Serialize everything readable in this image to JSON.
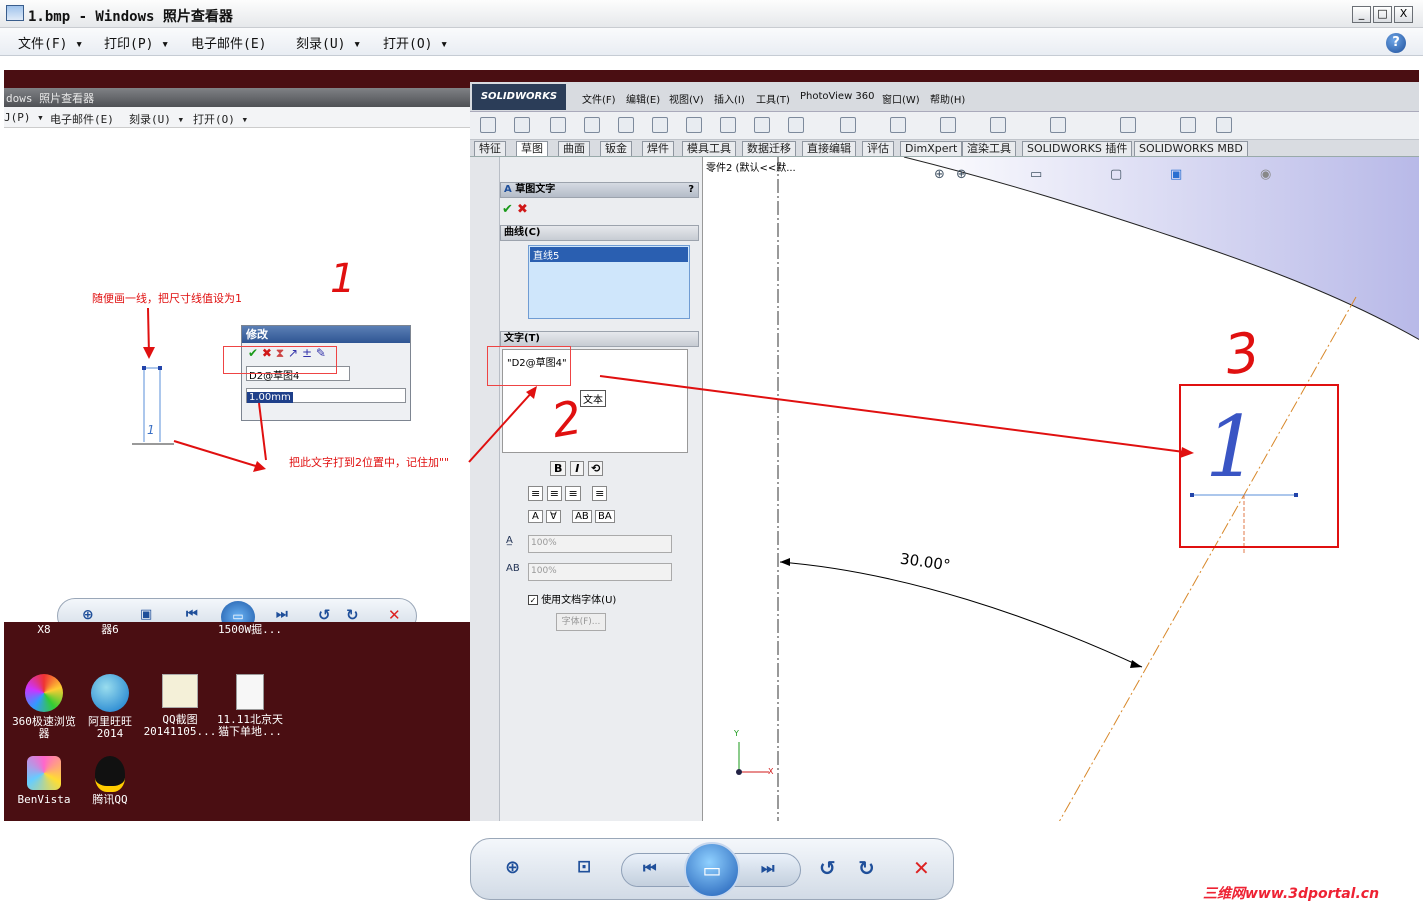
{
  "window": {
    "title": "1.bmp - Windows 照片查看器",
    "minimize": "_",
    "maximize": "□",
    "close": "X"
  },
  "menu": [
    "文件(F) ▾",
    "打印(P) ▾",
    "电子邮件(E)",
    "刻录(U) ▾",
    "打开(O) ▾"
  ],
  "help": "?",
  "inner_viewer": {
    "title": "dows 照片查看器",
    "menu": [
      "J(P) ▾",
      "电子邮件(E)",
      "刻录(U) ▾",
      "打开(O) ▾"
    ]
  },
  "annotations": {
    "a1": "随便画一线，把尺寸线值设为1",
    "a2": "把此文字打到2位置中，记住加\"\"",
    "n1": "1",
    "n2": "2",
    "n3": "3"
  },
  "modify_dialog": {
    "title": "修改",
    "field": "D2@草图4",
    "value": "1.00mm"
  },
  "small_dim": "1",
  "solidworks": {
    "logo": "SOLIDWORKS",
    "menu": [
      "文件(F)",
      "编辑(E)",
      "视图(V)",
      "插入(I)",
      "工具(T)",
      "PhotoView 360",
      "窗口(W)",
      "帮助(H)"
    ],
    "tabs": [
      "特征",
      "草图",
      "曲面",
      "钣金",
      "焊件",
      "模具工具",
      "数据迁移",
      "直接编辑",
      "评估",
      "DimXpert",
      "渲染工具",
      "SOLIDWORKS 插件",
      "SOLIDWORKS MBD"
    ],
    "pm": {
      "title": "草图文字",
      "help": "?",
      "curves_header": "曲线(C)",
      "curve_item": "直线5",
      "text_header": "文字(T)",
      "text_value": "\"D2@草图4\"",
      "tooltip": "文本",
      "pct1": "100%",
      "pct2": "100%",
      "checkbox": "使用文档字体(U)",
      "font_btn": "字体(F)..."
    },
    "tree": "零件2  (默认<<默..."
  },
  "graphics": {
    "angle": "30.00°",
    "dim": "1",
    "axis_x": "X",
    "axis_y": "Y"
  },
  "desktop": [
    {
      "l1": "X8",
      "l2": ""
    },
    {
      "l1": "器6",
      "l2": ""
    },
    {
      "l1": "1500W掘...",
      "l2": ""
    },
    {
      "l1": "360极速浏览",
      "l2": "器"
    },
    {
      "l1": "阿里旺旺",
      "l2": "2014"
    },
    {
      "l1": "QQ截图",
      "l2": "20141105..."
    },
    {
      "l1": "11.11北京天",
      "l2": "猫下单地..."
    },
    {
      "l1": "BenVista",
      "l2": ""
    },
    {
      "l1": "腾讯QQ",
      "l2": ""
    }
  ],
  "watermark": "三维网www.3dportal.cn",
  "colors": {
    "annotation": "#e01010",
    "accent": "#1f4f9a",
    "desktop": "#4a0e12"
  }
}
